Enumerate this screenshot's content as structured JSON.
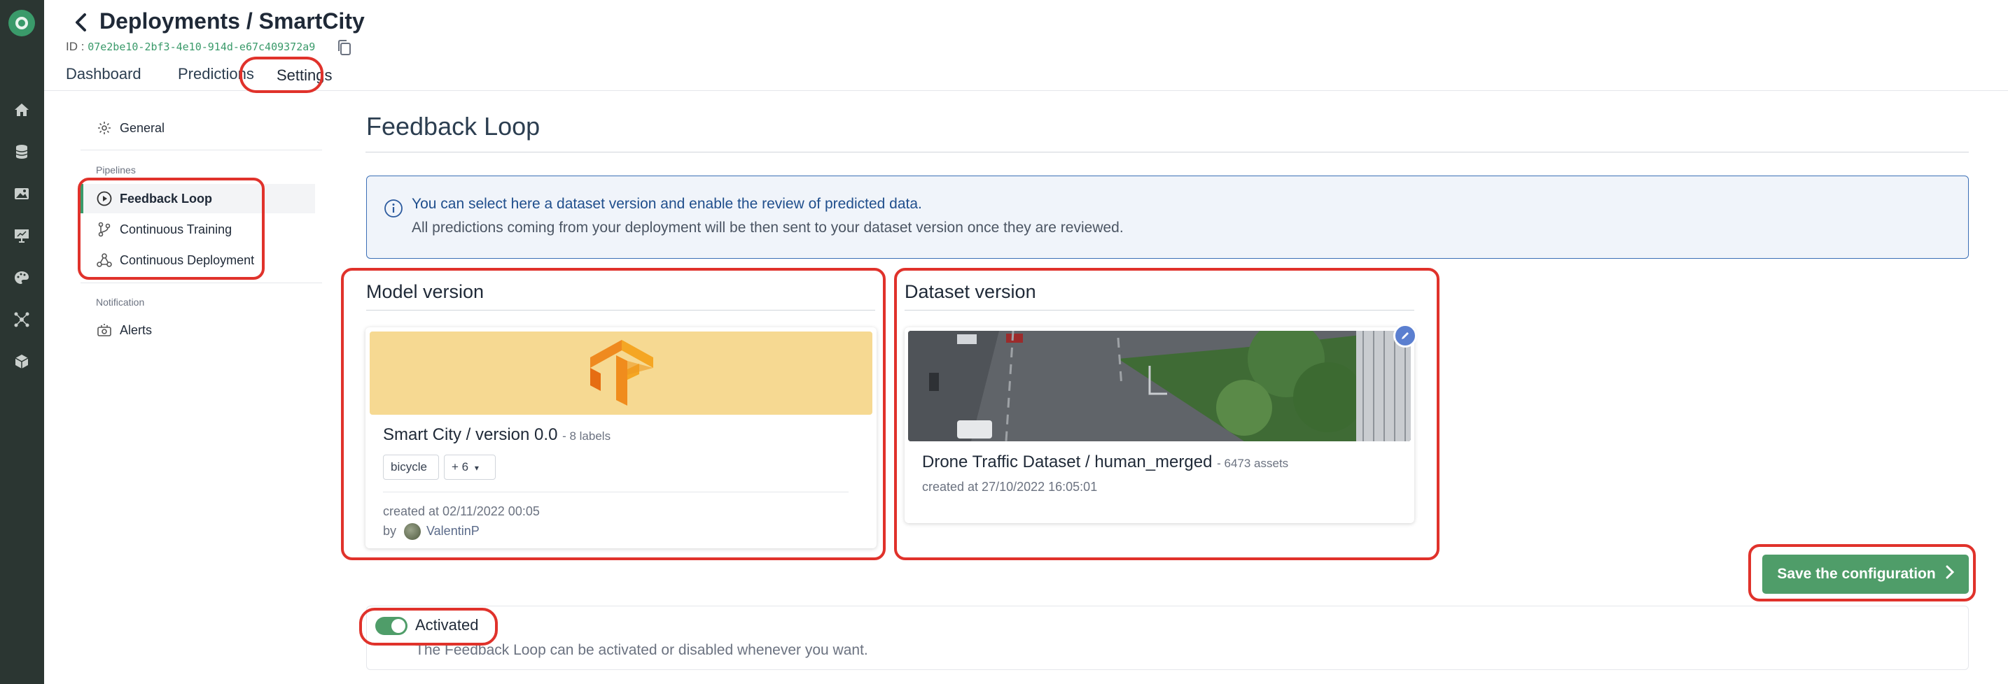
{
  "app": {
    "accent_color": "#3a9a6a",
    "highlight_color": "#e0322b",
    "rail_color": "#2b3632"
  },
  "rail": {
    "icons": [
      "home-icon",
      "database-icon",
      "image-icon",
      "presentation-icon",
      "palette-icon",
      "network-icon",
      "cube-icon"
    ]
  },
  "header": {
    "title": "Deployments / SmartCity",
    "id_label": "ID :",
    "id_value": "07e2be10-2bf3-4e10-914d-e67c409372a9",
    "tabs": [
      "Dashboard",
      "Predictions",
      "Settings"
    ],
    "active_tab": "Settings"
  },
  "sidebar": {
    "general": "General",
    "pipelines_title": "Pipelines",
    "pipelines": [
      "Feedback Loop",
      "Continuous Training",
      "Continuous Deployment"
    ],
    "active": "Feedback Loop",
    "notification_title": "Notification",
    "alerts": "Alerts"
  },
  "main": {
    "title": "Feedback Loop",
    "info_line1": "You can select here a dataset version and enable the review of predicted data.",
    "info_line2": "All predictions coming from your deployment will be then sent to your dataset version once they are reviewed.",
    "model_section": "Model version",
    "dataset_section": "Dataset version",
    "model": {
      "name": "Smart City / version 0.0",
      "labels_count": "- 8 labels",
      "chip": "bicycle",
      "more": "+ 6",
      "created": "created at 02/11/2022 00:05",
      "by": "by",
      "user": "ValentinP"
    },
    "dataset": {
      "name": "Drone Traffic Dataset / human_merged",
      "assets": "- 6473 assets",
      "created": "created at 27/10/2022 16:05:01"
    },
    "save_button": "Save the configuration",
    "activation": {
      "label": "Activated",
      "description": "The Feedback Loop can be activated or disabled whenever you want.",
      "enabled": true
    }
  }
}
